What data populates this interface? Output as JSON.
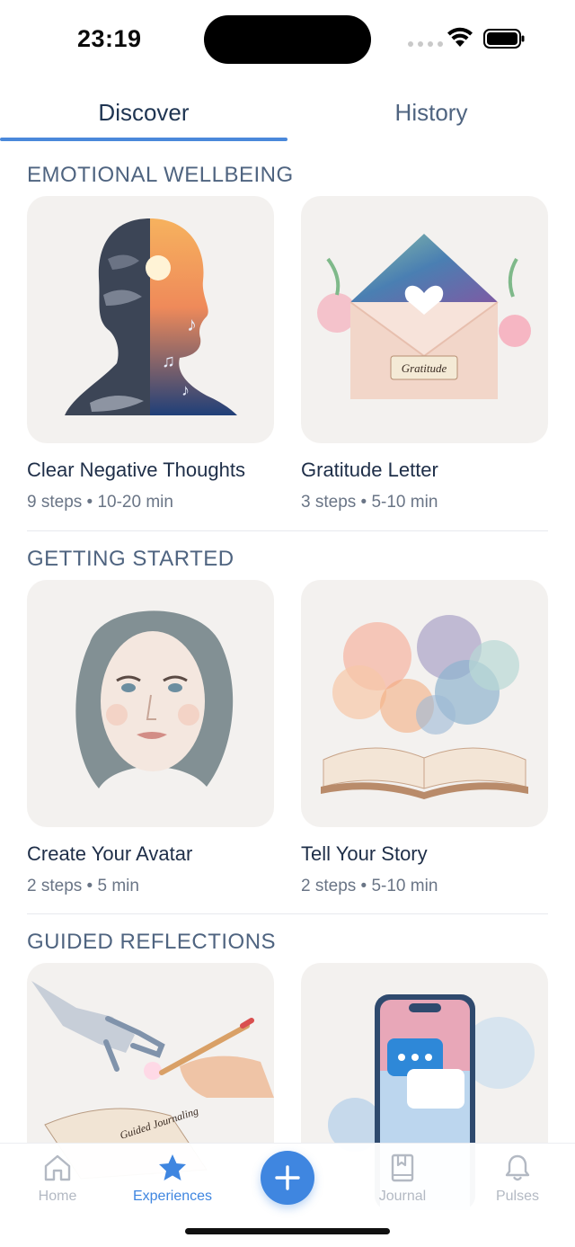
{
  "status_bar": {
    "time": "23:19"
  },
  "tabs": [
    {
      "label": "Discover",
      "active": true
    },
    {
      "label": "History",
      "active": false
    }
  ],
  "sections": [
    {
      "title": "EMOTIONAL WELLBEING",
      "cards": [
        {
          "title": "Clear Negative Thoughts",
          "meta": "9 steps • 10-20 min",
          "image_icon": "split-head-illustration"
        },
        {
          "title": "Gratitude Letter",
          "meta": "3 steps • 5-10 min",
          "image_icon": "envelope-illustration",
          "image_label": "Gratitude"
        }
      ]
    },
    {
      "title": "GETTING STARTED",
      "cards": [
        {
          "title": "Create Your Avatar",
          "meta": "2 steps • 5 min",
          "image_icon": "face-portrait-illustration"
        },
        {
          "title": "Tell Your Story",
          "meta": "2 steps • 5-10 min",
          "image_icon": "open-book-illustration"
        }
      ]
    },
    {
      "title": "GUIDED REFLECTIONS",
      "cards": [
        {
          "title": "",
          "meta": "",
          "image_icon": "robot-hand-journal-illustration",
          "image_label": "Guided Journaling"
        },
        {
          "title": "",
          "meta": "",
          "image_icon": "phone-chat-illustration"
        }
      ]
    }
  ],
  "bottom_nav": {
    "items": [
      {
        "label": "Home",
        "icon": "home-icon",
        "active": false
      },
      {
        "label": "Experiences",
        "icon": "star-icon",
        "active": true
      },
      {
        "label": "Journal",
        "icon": "journal-icon",
        "active": false
      },
      {
        "label": "Pulses",
        "icon": "bell-icon",
        "active": false
      }
    ],
    "add_icon": "plus-icon"
  },
  "colors": {
    "accent": "#3f86e0",
    "section_title": "#4f6480",
    "card_bg": "#f3f1ef"
  }
}
